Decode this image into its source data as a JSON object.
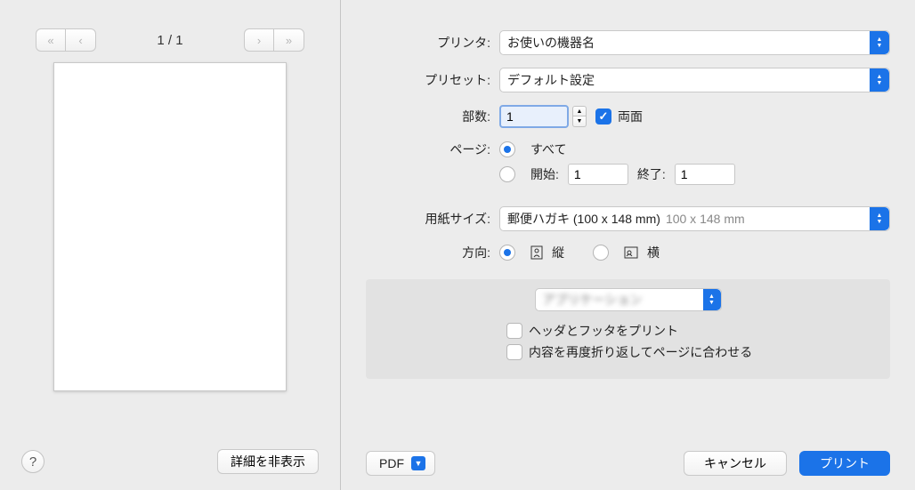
{
  "preview": {
    "page_count": "1 / 1"
  },
  "left": {
    "details_toggle": "詳細を非表示"
  },
  "labels": {
    "printer": "プリンタ:",
    "preset": "プリセット:",
    "copies": "部数:",
    "duplex": "両面",
    "pages": "ページ:",
    "pages_all": "すべて",
    "pages_from": "開始:",
    "pages_to": "終了:",
    "paper_size": "用紙サイズ:",
    "orientation": "方向:",
    "orient_portrait": "縦",
    "orient_horizontal": "横"
  },
  "values": {
    "printer": "お使いの機器名",
    "preset": "デフォルト設定",
    "copies": "1",
    "page_from": "1",
    "page_to": "1",
    "paper_size_main": "郵便ハガキ (100 x 148 mm)",
    "paper_size_dim": "100 x 148 mm"
  },
  "sub": {
    "headers_footers": "ヘッダとフッタをプリント",
    "rewrap": "内容を再度折り返してページに合わせる"
  },
  "footer": {
    "pdf": "PDF",
    "cancel": "キャンセル",
    "print": "プリント"
  }
}
